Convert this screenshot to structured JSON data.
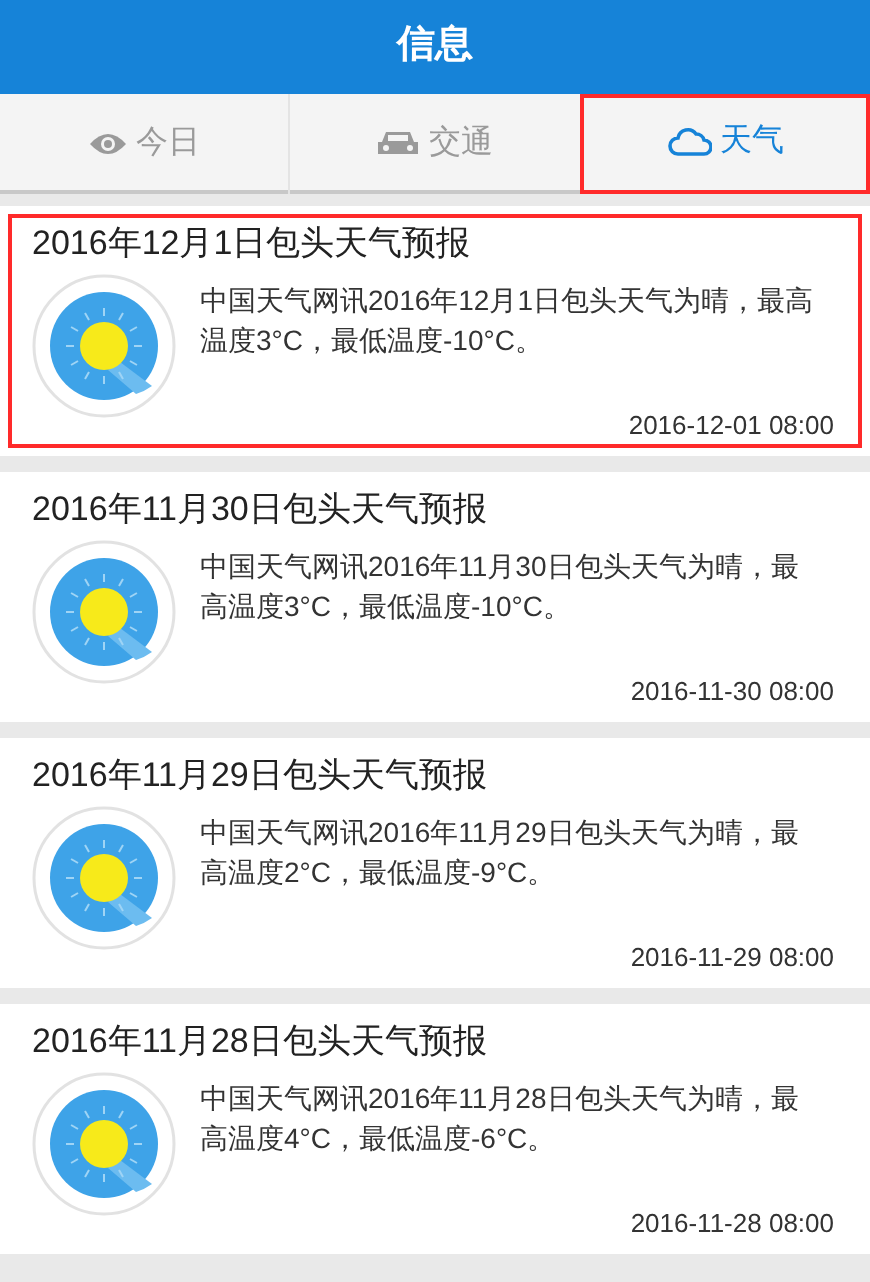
{
  "header": {
    "title": "信息"
  },
  "tabs": [
    {
      "label": "今日",
      "kind": "eye",
      "selected": false,
      "highlighted": false
    },
    {
      "label": "交通",
      "kind": "car",
      "selected": false,
      "highlighted": false
    },
    {
      "label": "天气",
      "kind": "cloud",
      "selected": true,
      "highlighted": true
    }
  ],
  "news": [
    {
      "title": "2016年12月1日包头天气预报",
      "summary": "中国天气网讯2016年12月1日包头天气为晴，最高温度3°C，最低温度-10°C。",
      "time": "2016-12-01 08:00",
      "highlighted": true
    },
    {
      "title": "2016年11月30日包头天气预报",
      "summary": "中国天气网讯2016年11月30日包头天气为晴，最高温度3°C，最低温度-10°C。",
      "time": "2016-11-30 08:00",
      "highlighted": false
    },
    {
      "title": "2016年11月29日包头天气预报",
      "summary": "中国天气网讯2016年11月29日包头天气为晴，最高温度2°C，最低温度-9°C。",
      "time": "2016-11-29 08:00",
      "highlighted": false
    },
    {
      "title": "2016年11月28日包头天气预报",
      "summary": "中国天气网讯2016年11月28日包头天气为晴，最高温度4°C，最低温度-6°C。",
      "time": "2016-11-28 08:00",
      "highlighted": false
    }
  ]
}
